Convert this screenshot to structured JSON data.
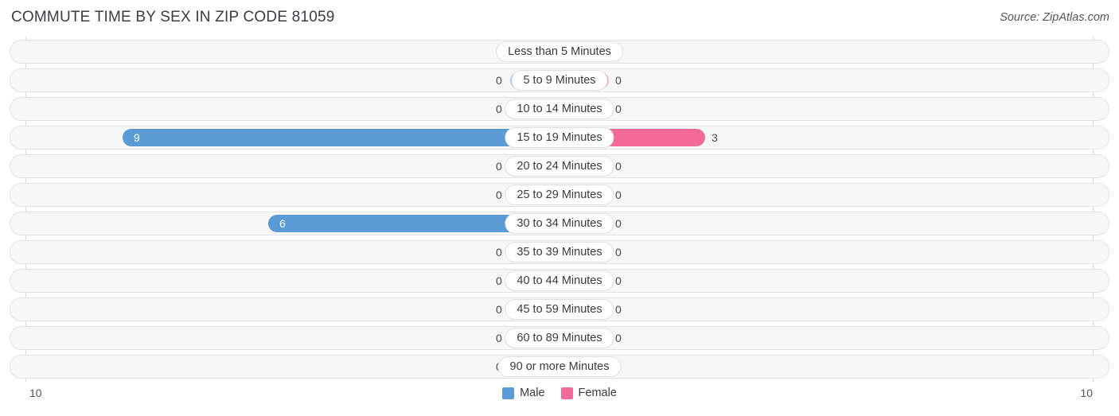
{
  "header": {
    "title": "COMMUTE TIME BY SEX IN ZIP CODE 81059",
    "source": "Source: ZipAtlas.com"
  },
  "legend": {
    "male": {
      "label": "Male",
      "color": "#5b9bd5"
    },
    "female": {
      "label": "Female",
      "color": "#f2699c"
    }
  },
  "axis": {
    "left_label": "10",
    "right_label": "10"
  },
  "chart_data": {
    "type": "bar",
    "title": "COMMUTE TIME BY SEX IN ZIP CODE 81059",
    "subtype": "diverging-horizontal-bar",
    "xlabel": "",
    "ylabel": "",
    "xlim": [
      10,
      10
    ],
    "grid": true,
    "legend_position": "bottom-center",
    "categories": [
      "Less than 5 Minutes",
      "5 to 9 Minutes",
      "10 to 14 Minutes",
      "15 to 19 Minutes",
      "20 to 24 Minutes",
      "25 to 29 Minutes",
      "30 to 34 Minutes",
      "35 to 39 Minutes",
      "40 to 44 Minutes",
      "45 to 59 Minutes",
      "60 to 89 Minutes",
      "90 or more Minutes"
    ],
    "series": [
      {
        "name": "Male",
        "direction": "left",
        "color": "#5b9bd5",
        "values": [
          0,
          0,
          0,
          9,
          0,
          0,
          6,
          0,
          0,
          0,
          0,
          0
        ]
      },
      {
        "name": "Female",
        "direction": "right",
        "color": "#f2699c",
        "values": [
          0,
          0,
          0,
          3,
          0,
          0,
          0,
          0,
          0,
          0,
          0,
          0
        ]
      }
    ],
    "rows": [
      {
        "label": "Less than 5 Minutes",
        "male": "0",
        "female": "0"
      },
      {
        "label": "5 to 9 Minutes",
        "male": "0",
        "female": "0"
      },
      {
        "label": "10 to 14 Minutes",
        "male": "0",
        "female": "0"
      },
      {
        "label": "15 to 19 Minutes",
        "male": "9",
        "female": "3"
      },
      {
        "label": "20 to 24 Minutes",
        "male": "0",
        "female": "0"
      },
      {
        "label": "25 to 29 Minutes",
        "male": "0",
        "female": "0"
      },
      {
        "label": "30 to 34 Minutes",
        "male": "6",
        "female": "0"
      },
      {
        "label": "35 to 39 Minutes",
        "male": "0",
        "female": "0"
      },
      {
        "label": "40 to 44 Minutes",
        "male": "0",
        "female": "0"
      },
      {
        "label": "45 to 59 Minutes",
        "male": "0",
        "female": "0"
      },
      {
        "label": "60 to 89 Minutes",
        "male": "0",
        "female": "0"
      },
      {
        "label": "90 or more Minutes",
        "male": "0",
        "female": "0"
      }
    ]
  }
}
